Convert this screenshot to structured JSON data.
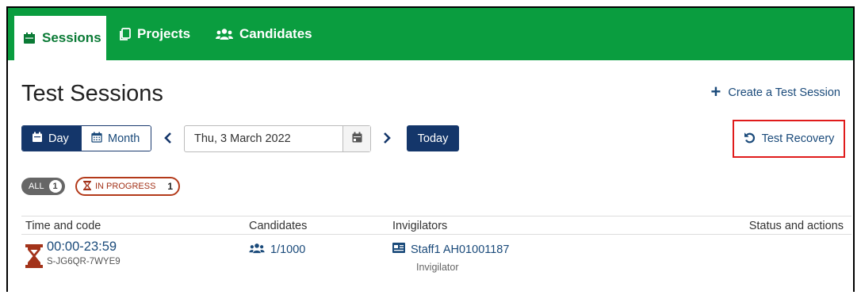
{
  "nav": {
    "tabs": [
      {
        "label": "Sessions",
        "icon": "calendar-icon",
        "active": true
      },
      {
        "label": "Projects",
        "icon": "copy-icon",
        "active": false
      },
      {
        "label": "Candidates",
        "icon": "users-icon",
        "active": false
      }
    ]
  },
  "page": {
    "title": "Test Sessions",
    "create_label": "Create a Test Session"
  },
  "toolbar": {
    "view_modes": [
      {
        "label": "Day",
        "selected": true
      },
      {
        "label": "Month",
        "selected": false
      }
    ],
    "date_value": "Thu, 3 March 2022",
    "today_label": "Today",
    "recovery_label": "Test Recovery"
  },
  "filters": {
    "all_label": "ALL",
    "all_count": "1",
    "in_progress_label": "IN PROGRESS",
    "in_progress_count": "1"
  },
  "table": {
    "headers": [
      "Time and code",
      "Candidates",
      "Invigilators",
      "Status and actions"
    ],
    "rows": [
      {
        "time": "00:00-23:59",
        "code": "S-JG6QR-7WYE9",
        "candidates": "1/1000",
        "invigilator_name": "Staff1 AH01001187",
        "invigilator_role": "Invigilator"
      }
    ]
  },
  "colors": {
    "nav_green": "#0a9d3f",
    "navy": "#14366a",
    "link_blue": "#1a4a7a",
    "in_progress_red": "#b33a1a",
    "highlight_red": "#e01b1b"
  }
}
